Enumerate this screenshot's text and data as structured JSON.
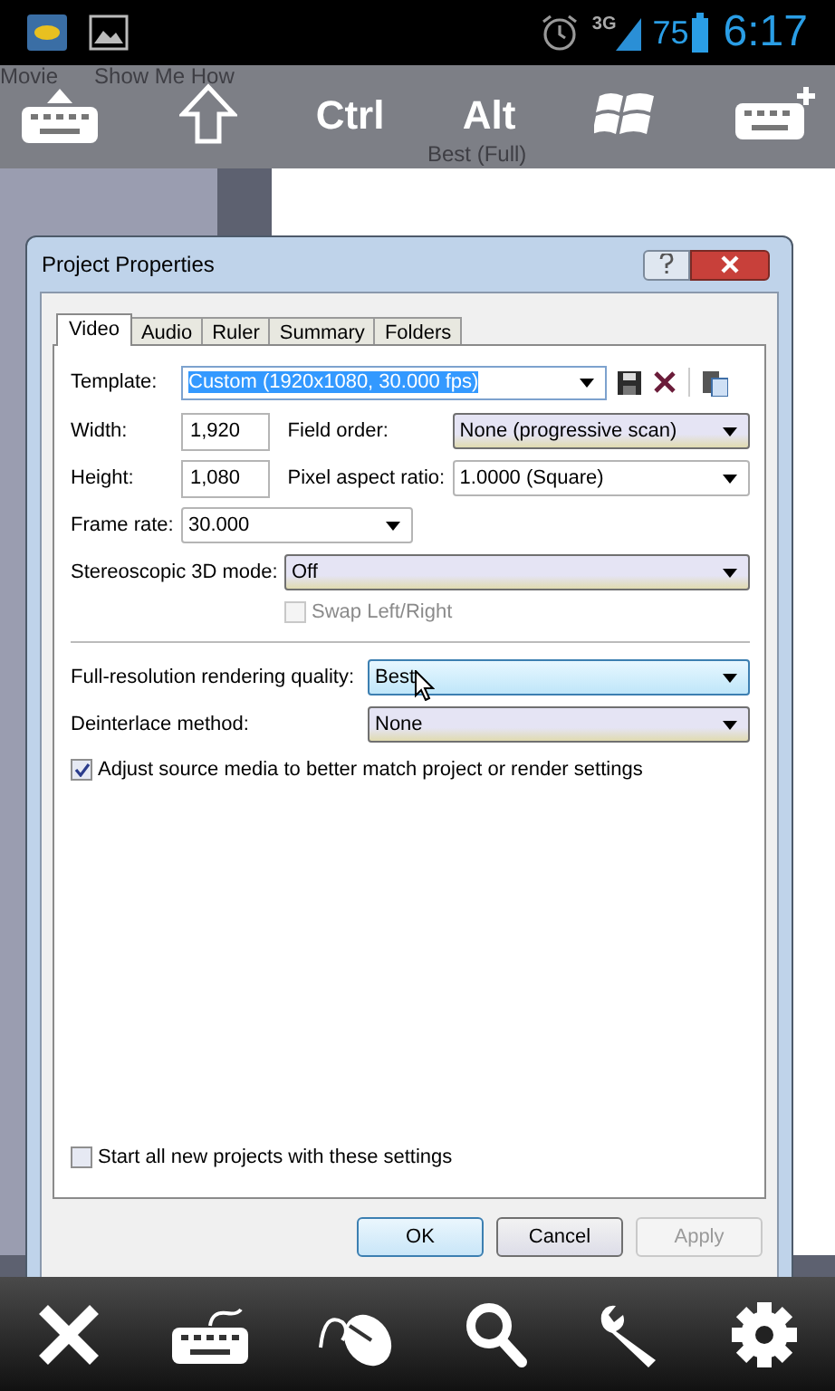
{
  "status_bar": {
    "network": "3G",
    "battery": "75",
    "time": "6:17"
  },
  "background_app": {
    "toolbar": [
      "Movie",
      "Show Me How"
    ],
    "preview_quality": "Best (Full)"
  },
  "overlay_keys": [
    {
      "kind": "keyboard"
    },
    {
      "kind": "shift"
    },
    {
      "kind": "text",
      "label": "Ctrl"
    },
    {
      "kind": "text",
      "label": "Alt"
    },
    {
      "kind": "windows"
    },
    {
      "kind": "keyboard_plus"
    }
  ],
  "dialog": {
    "title": "Project Properties",
    "tabs": [
      {
        "label": "Video",
        "selected": true
      },
      {
        "label": "Audio",
        "selected": false
      },
      {
        "label": "Ruler",
        "selected": false
      },
      {
        "label": "Summary",
        "selected": false
      },
      {
        "label": "Folders",
        "selected": false
      }
    ],
    "template": {
      "label": "Template:",
      "value": "Custom (1920x1080, 30.000 fps)"
    },
    "width": {
      "label": "Width:",
      "value": "1,920"
    },
    "field_order": {
      "label": "Field order:",
      "value": "None (progressive scan)",
      "kind": "shaded"
    },
    "height": {
      "label": "Height:",
      "value": "1,080"
    },
    "pixel_aspect_ratio": {
      "label": "Pixel aspect ratio:",
      "value": "1.0000 (Square)",
      "kind": "plain"
    },
    "frame_rate": {
      "label": "Frame rate:",
      "value": "30.000",
      "kind": "plain"
    },
    "stereoscopic_3d_mode": {
      "label": "Stereoscopic 3D mode:",
      "value": "Off",
      "kind": "shaded"
    },
    "swap_left_right": {
      "label": "Swap Left/Right",
      "checked": false,
      "disabled": true
    },
    "rendering_quality": {
      "label": "Full-resolution rendering quality:",
      "value": "Best",
      "kind": "hover"
    },
    "deinterlace_method": {
      "label": "Deinterlace method:",
      "value": "None",
      "kind": "shaded"
    },
    "adjust_source_media": {
      "label": "Adjust source media to better match project or render settings",
      "checked": true,
      "disabled": false
    },
    "start_all_new_projects": {
      "label": "Start all new projects with these settings",
      "checked": false,
      "disabled": false
    },
    "buttons": [
      {
        "label": "OK",
        "kind": "default",
        "disabled": false
      },
      {
        "label": "Cancel",
        "kind": "normal",
        "disabled": false
      },
      {
        "label": "Apply",
        "kind": "normal",
        "disabled": true
      }
    ]
  },
  "bottom_toolbar": [
    {
      "kind": "close"
    },
    {
      "kind": "keyboard"
    },
    {
      "kind": "mouse"
    },
    {
      "kind": "search"
    },
    {
      "kind": "wrench"
    },
    {
      "kind": "settings"
    }
  ]
}
